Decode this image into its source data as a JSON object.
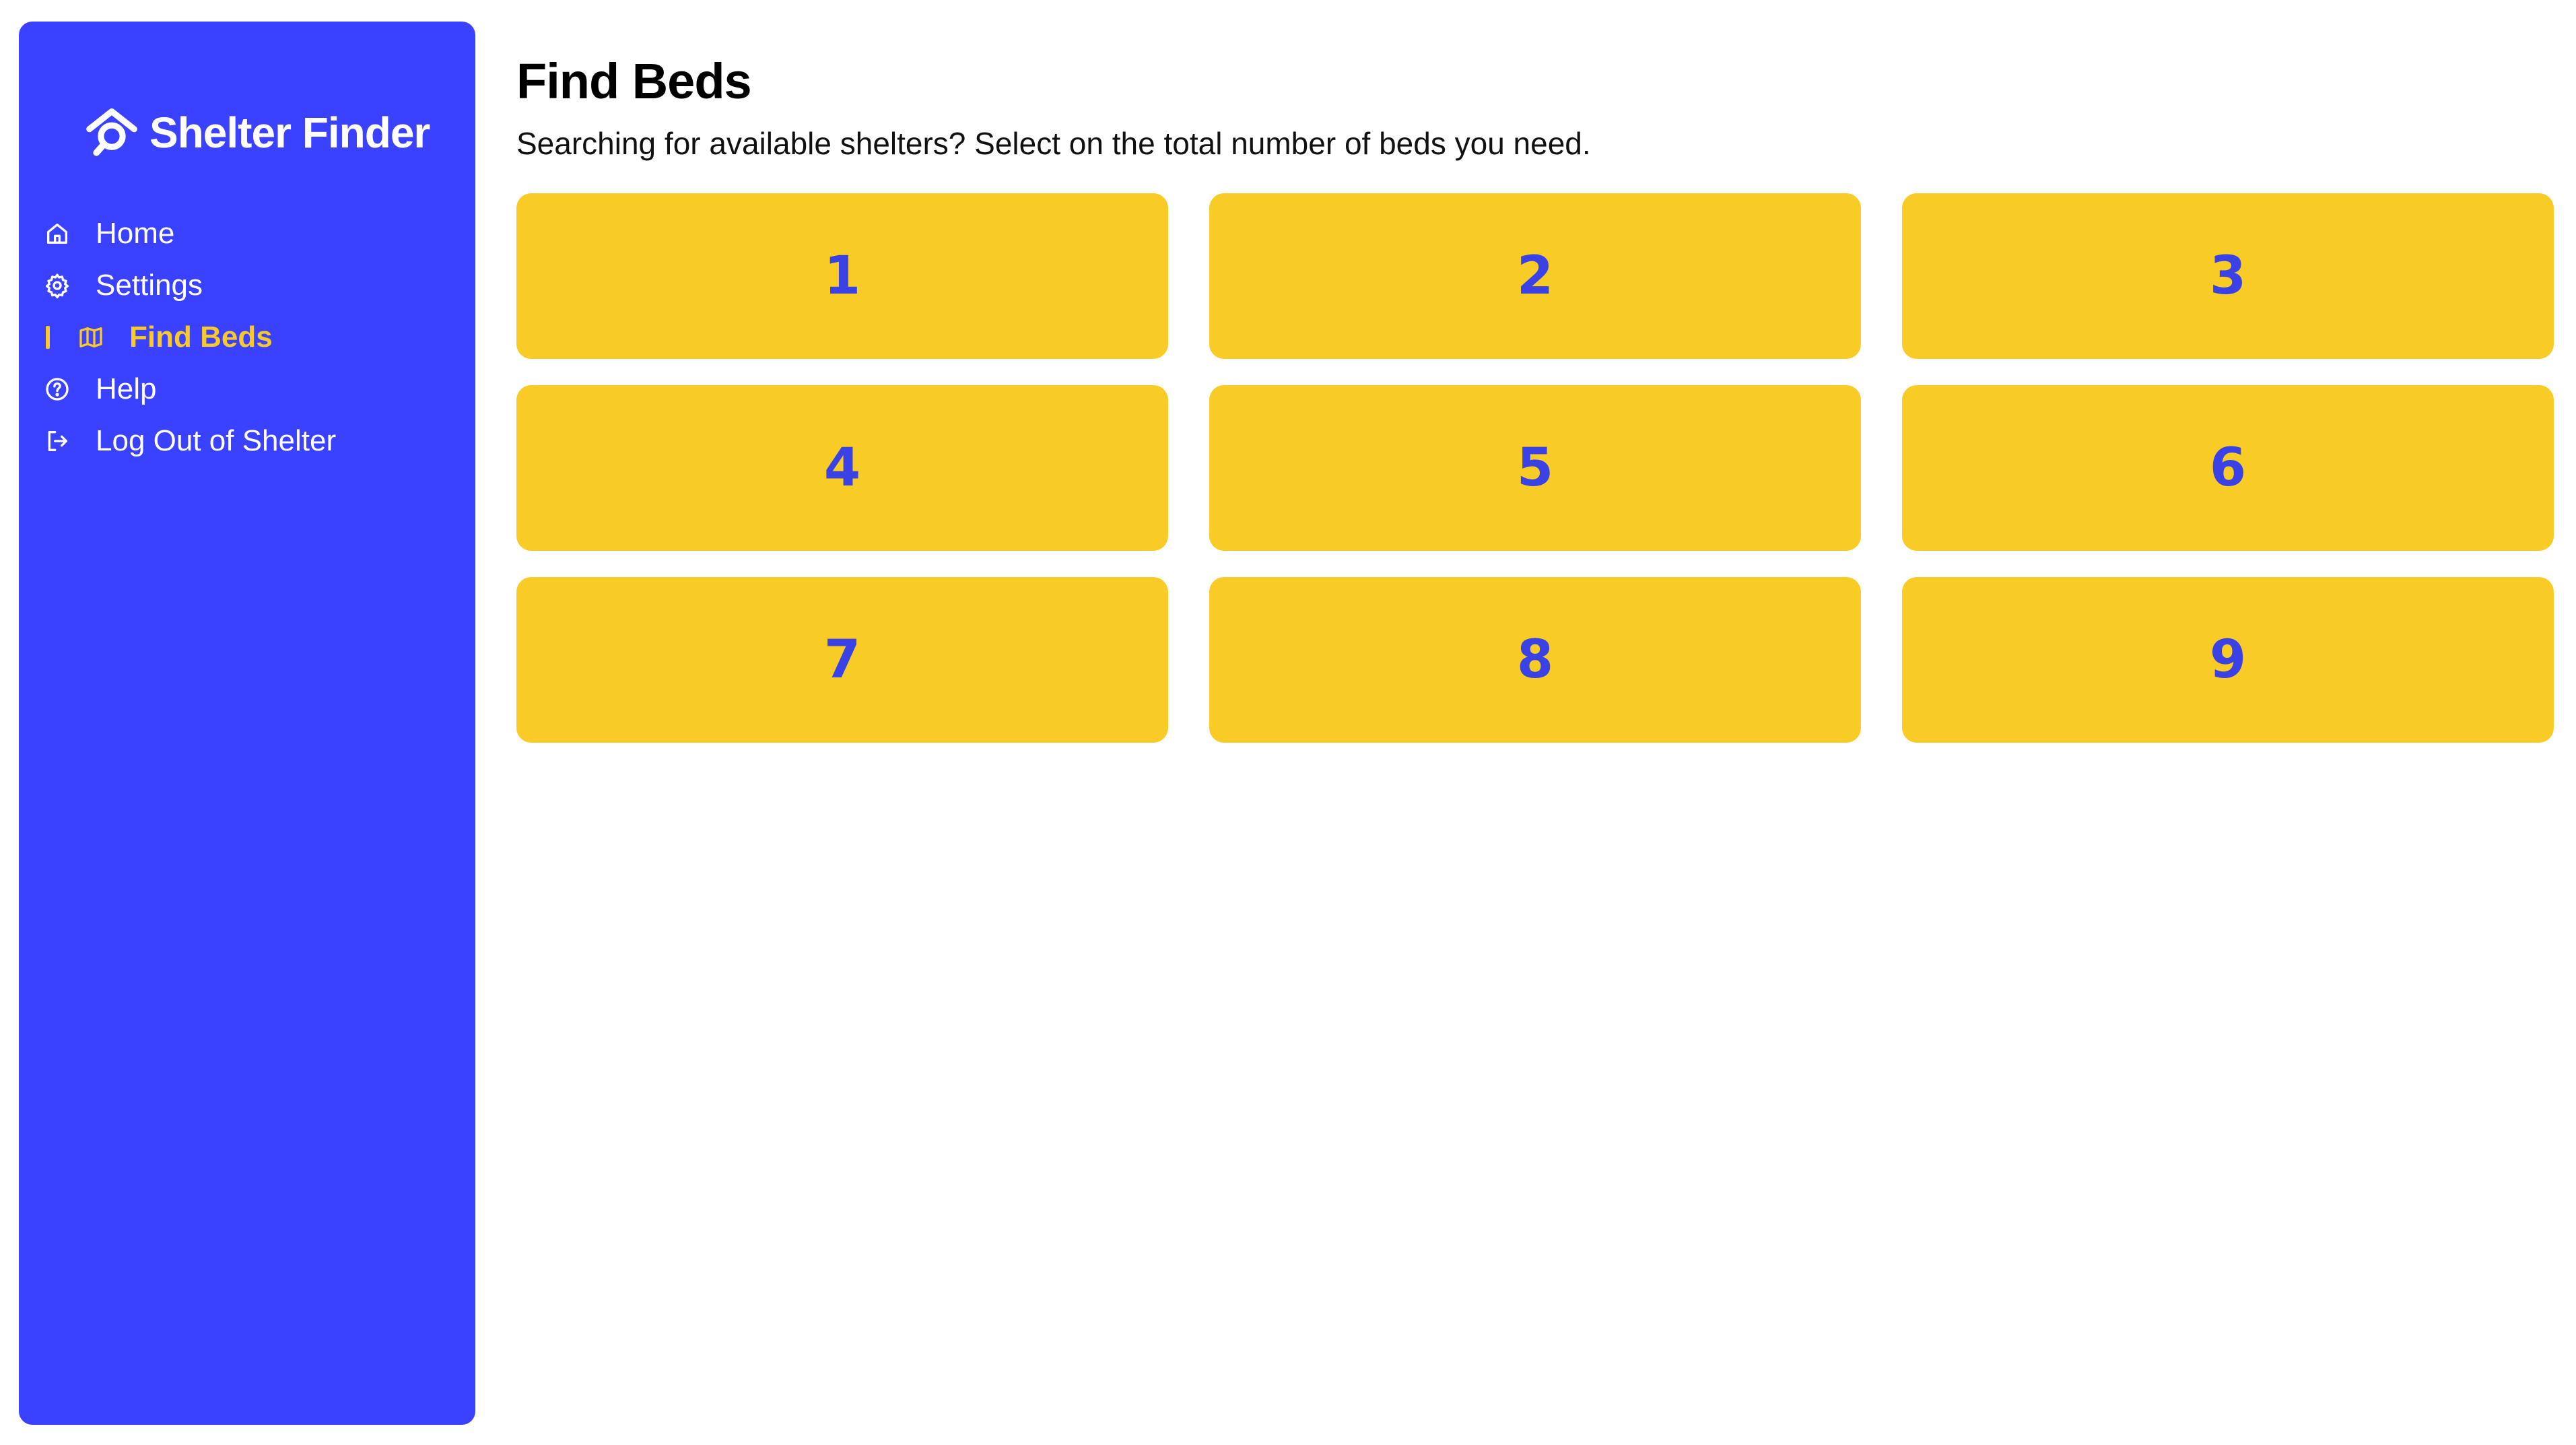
{
  "brand": {
    "name": "Shelter Finder",
    "logo_icon": "house-search-icon"
  },
  "colors": {
    "sidebar": "#3a42ff",
    "accent": "#f8c928",
    "button": "#f8cb26",
    "button_text": "#3a42e6"
  },
  "sidebar": {
    "items": [
      {
        "label": "Home",
        "icon": "home-icon",
        "active": false
      },
      {
        "label": "Settings",
        "icon": "gear-icon",
        "active": false
      },
      {
        "label": "Find Beds",
        "icon": "map-icon",
        "active": true
      },
      {
        "label": "Help",
        "icon": "help-circle-icon",
        "active": false
      },
      {
        "label": "Log Out of Shelter",
        "icon": "logout-icon",
        "active": false
      }
    ]
  },
  "main": {
    "title": "Find Beds",
    "subtitle": "Searching for available shelters? Select on the total number of beds you need.",
    "bed_options": [
      "1",
      "2",
      "3",
      "4",
      "5",
      "6",
      "7",
      "8",
      "9"
    ]
  }
}
